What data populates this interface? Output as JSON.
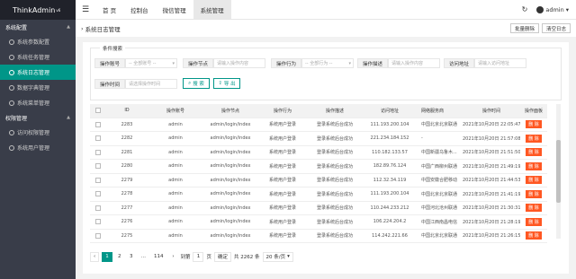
{
  "app": {
    "brand": "ThinkAdmin",
    "version": "v6"
  },
  "sidebar": {
    "groups": [
      {
        "title": "系统配置",
        "items": [
          {
            "label": "系统参数配置"
          },
          {
            "label": "系统任务管理"
          },
          {
            "label": "系统日志管理"
          },
          {
            "label": "数据字典管理"
          },
          {
            "label": "系统菜单管理"
          }
        ]
      },
      {
        "title": "权限管理",
        "items": [
          {
            "label": "访问权限管理"
          },
          {
            "label": "系统用户管理"
          }
        ]
      }
    ]
  },
  "header": {
    "tabs": [
      "首 页",
      "控制台",
      "微信管理",
      "系统管理"
    ],
    "user": "admin"
  },
  "crumb": {
    "title": "系统日志管理",
    "batch_delete": "批量删除",
    "clear_log": "清空日志"
  },
  "search": {
    "legend": "条件搜索",
    "fields": [
      {
        "label": "操作账号",
        "placeholder": "-- 全部账号 --"
      },
      {
        "label": "操作节点",
        "placeholder": "请输入操作内容"
      },
      {
        "label": "操作行为",
        "placeholder": "-- 全部行为 --"
      },
      {
        "label": "操作描述",
        "placeholder": "请输入操作内容"
      },
      {
        "label": "访问地址",
        "placeholder": "请输入访问地址"
      },
      {
        "label": "操作时间",
        "placeholder": "请选择操作时间"
      }
    ],
    "search_btn": "搜 索",
    "export_btn": "导 出"
  },
  "table": {
    "columns": [
      "ID",
      "操作账号",
      "操作节点",
      "操作行为",
      "操作描述",
      "访问地址",
      "网络服务商",
      "操作时间",
      "操作面板"
    ],
    "rows": [
      {
        "id": "2283",
        "user": "admin",
        "node": "admin/login/index",
        "action": "系统用户登录",
        "desc": "登录系统后台成功",
        "ip": "111.193.200.104",
        "loc": "中国北京北京联通",
        "time": "2021年10月20日 22:05:47"
      },
      {
        "id": "2282",
        "user": "admin",
        "node": "admin/login/index",
        "action": "系统用户登录",
        "desc": "登录系统后台成功",
        "ip": "221.234.184.152",
        "loc": "-",
        "time": "2021年10月20日 21:57:08"
      },
      {
        "id": "2281",
        "user": "admin",
        "node": "admin/login/index",
        "action": "系统用户登录",
        "desc": "登录系统后台成功",
        "ip": "110.182.133.57",
        "loc": "中国新疆乌鲁木...",
        "time": "2021年10月20日 21:51:50"
      },
      {
        "id": "2280",
        "user": "admin",
        "node": "admin/login/index",
        "action": "系统用户登录",
        "desc": "登录系统后台成功",
        "ip": "182.89.76.124",
        "loc": "中国广西柳州联通",
        "time": "2021年10月20日 21:49:19"
      },
      {
        "id": "2279",
        "user": "admin",
        "node": "admin/login/index",
        "action": "系统用户登录",
        "desc": "登录系统后台成功",
        "ip": "112.32.34.119",
        "loc": "中国安徽合肥移动",
        "time": "2021年10月20日 21:44:53"
      },
      {
        "id": "2278",
        "user": "admin",
        "node": "admin/login/index",
        "action": "系统用户登录",
        "desc": "登录系统后台成功",
        "ip": "111.193.200.104",
        "loc": "中国北京北京联通",
        "time": "2021年10月20日 21:41:19"
      },
      {
        "id": "2277",
        "user": "admin",
        "node": "admin/login/index",
        "action": "系统用户登录",
        "desc": "登录系统后台成功",
        "ip": "110.244.233.212",
        "loc": "中国河北沧州联通",
        "time": "2021年10月20日 21:30:31"
      },
      {
        "id": "2276",
        "user": "admin",
        "node": "admin/login/index",
        "action": "系统用户登录",
        "desc": "登录系统后台成功",
        "ip": "106.224.204.2",
        "loc": "中国江西南昌电信",
        "time": "2021年10月20日 21:28:19"
      },
      {
        "id": "2275",
        "user": "admin",
        "node": "admin/login/index",
        "action": "系统用户登录",
        "desc": "登录系统后台成功",
        "ip": "114.242.221.66",
        "loc": "中国北京北京联通",
        "time": "2021年10月20日 21:26:15"
      }
    ],
    "delete_label": "删 除"
  },
  "pager": {
    "pages": [
      "1",
      "2",
      "3",
      "...",
      "114"
    ],
    "goto_label": "到第",
    "goto_value": "1",
    "page_unit": "页",
    "confirm": "确定",
    "total": "共 2262 条",
    "per_page": "20 条/页"
  },
  "colors": {
    "accent": "#009688",
    "danger": "#ff5722",
    "sidebar": "#393d49"
  }
}
